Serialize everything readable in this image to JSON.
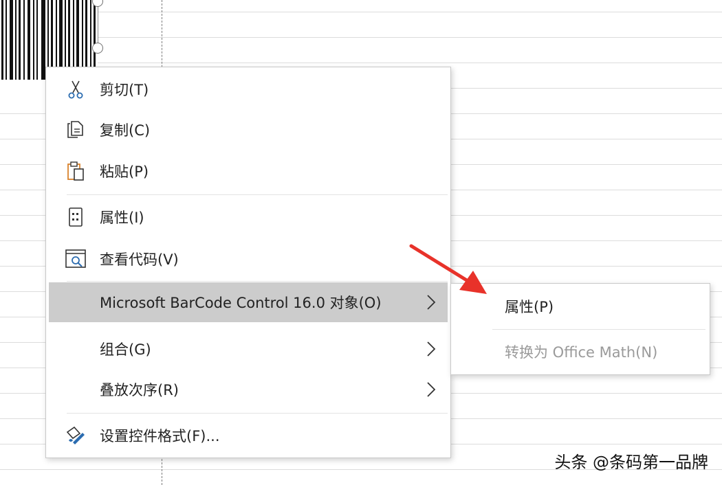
{
  "context_menu": {
    "items": [
      {
        "label": "剪切(T)",
        "icon": "scissors-icon"
      },
      {
        "label": "复制(C)",
        "icon": "copy-icon"
      },
      {
        "label": "粘贴(P)",
        "icon": "paste-icon"
      },
      {
        "label": "属性(I)",
        "icon": "properties-icon"
      },
      {
        "label": "查看代码(V)",
        "icon": "view-code-icon"
      },
      {
        "label": "Microsoft BarCode Control 16.0 对象(O)",
        "submenu": true,
        "highlighted": true
      },
      {
        "label": "组合(G)",
        "submenu": true
      },
      {
        "label": "叠放次序(R)",
        "submenu": true
      },
      {
        "label": "设置控件格式(F)...",
        "icon": "format-control-icon"
      }
    ]
  },
  "submenu": {
    "items": [
      {
        "label": "属性(P)",
        "enabled": true
      },
      {
        "label": "转换为 Office Math(N)",
        "enabled": false
      }
    ]
  },
  "annotation": {
    "arrow_color": "#e8322a"
  },
  "watermark": "头条 @条码第一品牌",
  "colors": {
    "highlight": "#cccccc",
    "icon_blue": "#2b6cb0",
    "icon_orange": "#d9822b"
  }
}
